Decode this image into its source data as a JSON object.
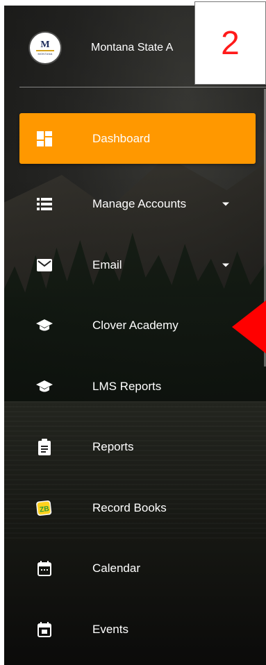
{
  "header": {
    "org_name": "Montana State A",
    "logo_initial": "M",
    "logo_text": "MONTANA"
  },
  "badge": {
    "label": "2"
  },
  "nav": {
    "items": [
      {
        "label": "Dashboard",
        "icon": "dashboard-icon",
        "active": true
      },
      {
        "label": "Manage Accounts",
        "icon": "list-icon",
        "has_dropdown": true
      },
      {
        "label": "Email",
        "icon": "envelope-icon",
        "has_dropdown": true
      },
      {
        "label": "Clover Academy",
        "icon": "graduation-cap-icon"
      },
      {
        "label": "LMS Reports",
        "icon": "graduation-cap-icon"
      },
      {
        "label": "Reports",
        "icon": "clipboard-icon"
      },
      {
        "label": "Record Books",
        "icon": "zb-app-icon",
        "icon_text": "ZB"
      },
      {
        "label": "Calendar",
        "icon": "calendar-icon"
      },
      {
        "label": "Events",
        "icon": "event-icon"
      }
    ]
  },
  "colors": {
    "active_bg": "#ff9800",
    "text": "#ffffff",
    "badge_text": "#ff1a1a",
    "arrow": "#ff0000"
  }
}
